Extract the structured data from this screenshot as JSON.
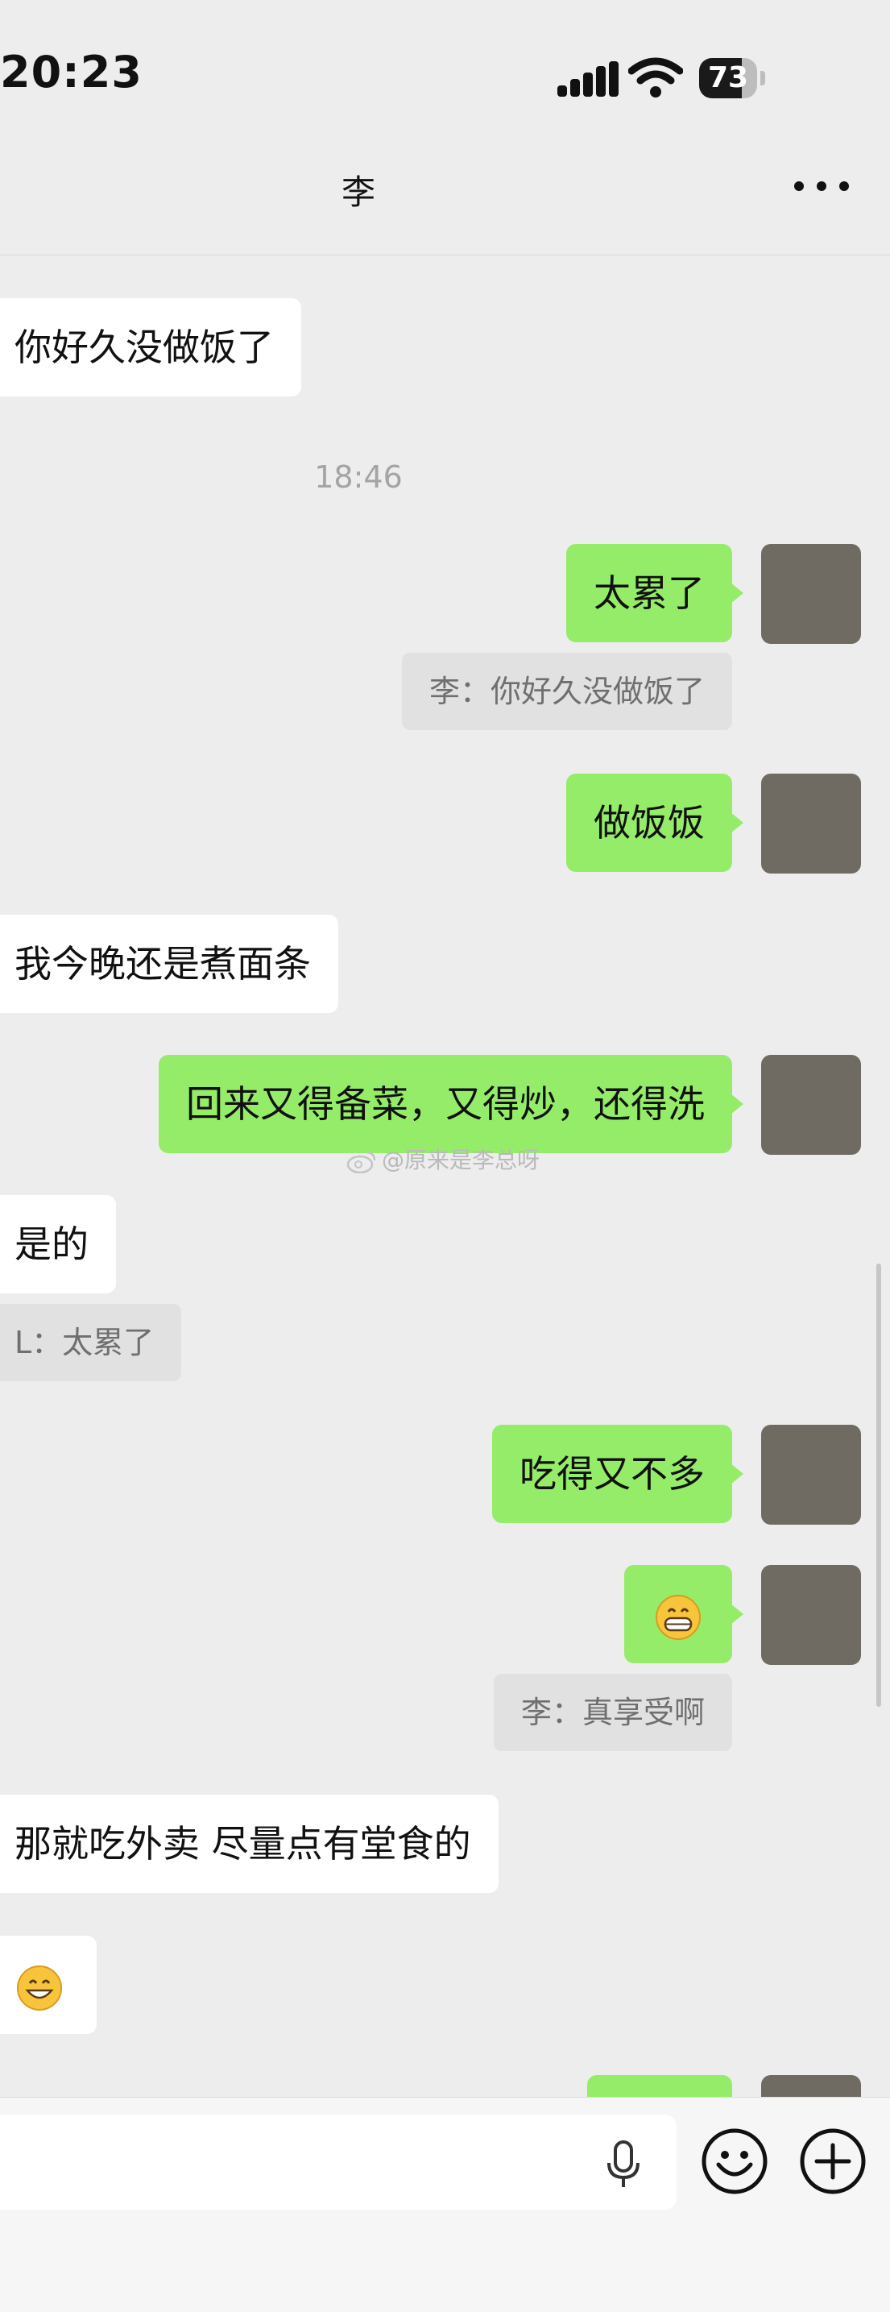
{
  "status_bar": {
    "time": "20:23",
    "battery_level": "73",
    "battery_fraction": 0.73
  },
  "nav": {
    "title": "李"
  },
  "messages": [
    {
      "side": "in",
      "text": "你好久没做饭了"
    },
    {
      "timestamp": "18:46"
    },
    {
      "side": "out",
      "text": "太累了"
    },
    {
      "quote": "李：你好久没做饭了"
    },
    {
      "side": "out",
      "text": "做饭饭"
    },
    {
      "side": "in",
      "text": "我今晚还是煮面条"
    },
    {
      "side": "out",
      "text": "回来又得备菜，又得炒，还得洗"
    },
    {
      "side": "in",
      "text": "是的"
    },
    {
      "quote": "L：太累了"
    },
    {
      "side": "out",
      "text": "吃得又不多"
    },
    {
      "side": "out",
      "emoji": "grin"
    },
    {
      "quote": "李：真享受啊"
    },
    {
      "side": "in",
      "text": "那就吃外卖 尽量点有堂食的"
    },
    {
      "side": "in",
      "emoji": "smile"
    }
  ],
  "watermark": {
    "text": "@原来是李总呀"
  },
  "colors": {
    "background": "#ededed",
    "outgoing_bubble": "#95ec69",
    "incoming_bubble": "#ffffff",
    "quote_bg": "#e1e1e1"
  },
  "icons": {
    "more": "more-icon",
    "mic": "mic-icon",
    "emoji": "emoji-icon",
    "plus": "plus-icon",
    "signal": "signal-icon",
    "wifi": "wifi-icon"
  }
}
